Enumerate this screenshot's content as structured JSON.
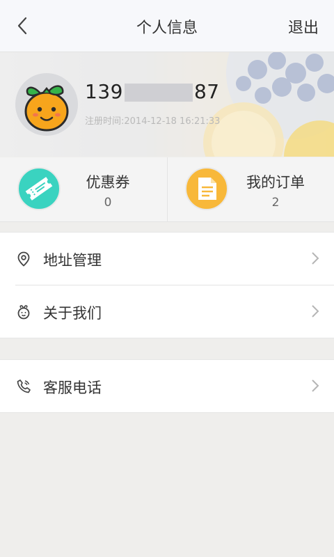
{
  "header": {
    "title": "个人信息",
    "logout_label": "退出"
  },
  "profile": {
    "phone_prefix": "139",
    "phone_suffix": "87",
    "registration": "注册时间:2014-12-18 16:21:33"
  },
  "stats": [
    {
      "label": "优惠券",
      "count": "0",
      "icon": "ticket-icon",
      "color": "#3ad3c0"
    },
    {
      "label": "我的订单",
      "count": "2",
      "icon": "document-icon",
      "color": "#f8b83a"
    }
  ],
  "menu_groups": [
    [
      {
        "label": "地址管理",
        "icon": "location-pin-icon"
      },
      {
        "label": "关于我们",
        "icon": "mascot-face-icon"
      }
    ],
    [
      {
        "label": "客服电话",
        "icon": "phone-icon"
      }
    ]
  ],
  "colors": {
    "background": "#efeeec",
    "header": "#f7f8fb",
    "coupon": "#3ad3c0",
    "orders": "#f8b83a"
  }
}
